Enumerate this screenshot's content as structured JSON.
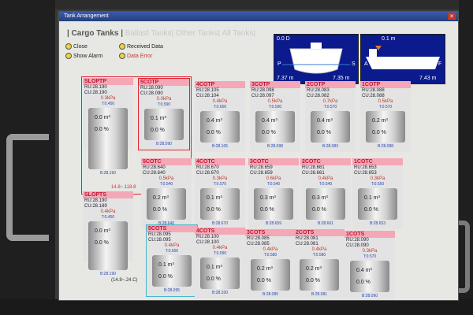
{
  "window": {
    "title": "Tank Arrangement"
  },
  "tabs": [
    {
      "label": "Cargo Tanks",
      "active": true
    },
    {
      "label": "Ballast Tanks",
      "active": false
    },
    {
      "label": "Other Tanks",
      "active": false
    },
    {
      "label": "All Tanks",
      "active": false
    }
  ],
  "controls": {
    "close": "Close",
    "show_alarm": "Show Alarm",
    "received_data": "Received Data",
    "data_error": "Data Error"
  },
  "ship_panels": [
    {
      "top_label": "0.0 D",
      "left_label": "P",
      "right_label": "S",
      "bottom_left": "7.37 m",
      "bottom_right": "7.35 m"
    },
    {
      "top_label": "0.1 m",
      "left_label": "A",
      "right_label": "F",
      "bottom_left": "",
      "bottom_right": "7.43 m"
    }
  ],
  "tanks": [
    {
      "name": "SLOPTP",
      "ru": "RU:28.190",
      "cu": "CU:28.190",
      "kpa": "0.3kPa",
      "tp": "T:0.450",
      "vol": "0.0 m³",
      "pct": "0.0 %",
      "bval": "B:28.190"
    },
    {
      "name": "5COTP",
      "ru": "RU:28.090",
      "cu": "CU:28.090",
      "kpa": "0.0kPa",
      "tp": "T:0.590",
      "vol": "0.1 m³",
      "pct": "0.0 %",
      "bval": "B:28.090"
    },
    {
      "name": "4COTP",
      "ru": "RU:28.105",
      "cu": "CU:28.104",
      "kpa": "0.4kPa",
      "tp": "T:0.600",
      "vol": "0.4 m³",
      "pct": "0.0 %",
      "bval": "B:28.105"
    },
    {
      "name": "3COTP",
      "ru": "RU:28.098",
      "cu": "CU:28.097",
      "kpa": "0.5kPa",
      "tp": "T:0.590",
      "vol": "0.4 m³",
      "pct": "0.0 %",
      "bval": "B:28.098"
    },
    {
      "name": "2COTP",
      "ru": "RU:28.083",
      "cu": "CU:28.082",
      "kpa": "0.7kPa",
      "tp": "T:0.570",
      "vol": "0.4 m³",
      "pct": "0.0 %",
      "bval": "B:28.083"
    },
    {
      "name": "1COTP",
      "ru": "RU:28.088",
      "cu": "CU:28.088",
      "kpa": "0.5kPa",
      "tp": "T:0.570",
      "vol": "0.2 m³",
      "pct": "0.0 %",
      "bval": "B:28.088"
    },
    {
      "name": "5COTC",
      "ru": "RU:28.640",
      "cu": "CU:28.640",
      "kpa": "0.5kPa",
      "tp": "T:0.540",
      "vol": "0.2 m³",
      "pct": "0.0 %",
      "bval": "B:28.640"
    },
    {
      "name": "4COTC",
      "ru": "RU:28.670",
      "cu": "CU:28.670",
      "kpa": "0.3kPa",
      "tp": "T:0.570",
      "vol": "0.1 m³",
      "pct": "0.0 %",
      "bval": "B:28.670"
    },
    {
      "name": "3COTC",
      "ru": "RU:28.659",
      "cu": "CU:28.659",
      "kpa": "0.6kPa",
      "tp": "T:0.540",
      "vol": "0.3 m³",
      "pct": "0.0 %",
      "bval": "B:28.659"
    },
    {
      "name": "2COTC",
      "ru": "RU:28.661",
      "cu": "CU:28.661",
      "kpa": "0.4kPa",
      "tp": "T:0.540",
      "vol": "0.3 m³",
      "pct": "0.0 %",
      "bval": "B:28.661"
    },
    {
      "name": "1COTC",
      "ru": "RU:28.653",
      "cu": "CU:28.653",
      "kpa": "0.3kPa",
      "tp": "T:0.550",
      "vol": "0.1 m³",
      "pct": "0.0 %",
      "bval": "B:28.653"
    },
    {
      "name": "SLOPTS",
      "ru": "RU:28.190",
      "cu": "CU:28.189",
      "kpa": "0.4kPa",
      "tp": "T:0.450",
      "vol": "0.0 m³",
      "pct": "0.0 %",
      "bval": "B:28.190"
    },
    {
      "name": "5COTS",
      "ru": "RU:28.095",
      "cu": "CU:28.095",
      "kpa": "0.4kPa",
      "tp": "T:0.600",
      "vol": "0.1 m³",
      "pct": "0.0 %",
      "bval": "B:28.095"
    },
    {
      "name": "4COTS",
      "ru": "RU:28.100",
      "cu": "CU:28.100",
      "kpa": "0.4kPa",
      "tp": "T:0.590",
      "vol": "0.1 m³",
      "pct": "0.0 %",
      "bval": "B:28.100"
    },
    {
      "name": "3COTS",
      "ru": "RU:28.085",
      "cu": "CU:28.085",
      "kpa": "0.4kPa",
      "tp": "T:0.580",
      "vol": "0.2 m³",
      "pct": "0.0 %",
      "bval": "B:28.085"
    },
    {
      "name": "2COTS",
      "ru": "RU:28.081",
      "cu": "CU:28.081",
      "kpa": "0.4kPa",
      "tp": "T:0.580",
      "vol": "0.2 m³",
      "pct": "0.0 %",
      "bval": "B:28.081"
    },
    {
      "name": "1COTS",
      "ru": "RU:28.090",
      "cu": "CU:28.090",
      "kpa": "0.3kPa",
      "tp": "T:0.570",
      "vol": "0.4 m³",
      "pct": "0.0 %",
      "bval": "B:28.090"
    }
  ],
  "misc": {
    "slop_temp": "14.8~.118.8",
    "slops_temp": "(14.8~.24.C)"
  }
}
